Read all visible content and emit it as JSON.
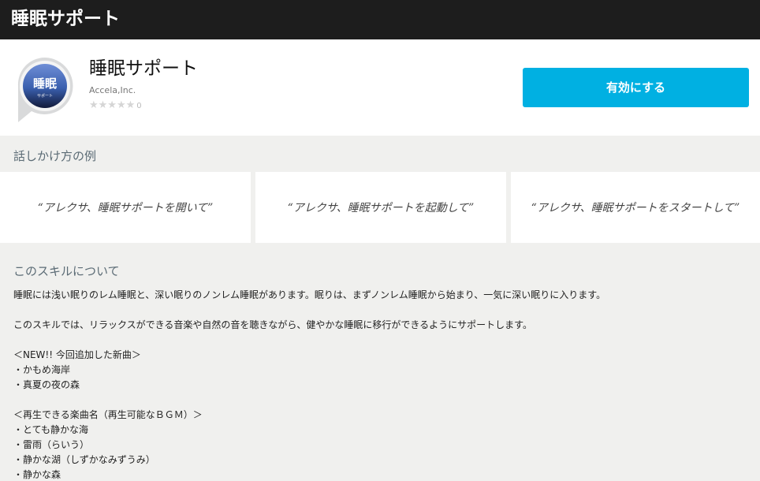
{
  "topbar": {
    "title": "睡眠サポート"
  },
  "skill": {
    "icon_text": "睡眠",
    "icon_subtext": "サポート",
    "name": "睡眠サポート",
    "developer": "Accela,Inc.",
    "stars": "★★★★★",
    "rating_count": "0",
    "enable_label": "有効にする"
  },
  "colors": {
    "accent": "#00b0e2",
    "topbar_bg": "#1d1d1d",
    "heading": "#5b6b75",
    "icon_blue": "#3a5fae"
  },
  "examples": {
    "heading": "話しかけ方の例",
    "items": [
      "“アレクサ、睡眠サポートを開いて”",
      "“アレクサ、睡眠サポートを起動して”",
      "“アレクサ、睡眠サポートをスタートして”"
    ]
  },
  "about": {
    "heading": "このスキルについて",
    "lines": [
      "睡眠には浅い眠りのレム睡眠と、深い眠りのノンレム睡眠があります。眠りは、まずノンレム睡眠から始まり、一気に深い眠りに入ります。",
      "",
      "このスキルでは、リラックスができる音楽や自然の音を聴きながら、健やかな睡眠に移行ができるようにサポートします。",
      "",
      "＜NEW!! 今回追加した新曲＞",
      "・かもめ海岸",
      "・真夏の夜の森",
      "",
      "＜再生できる楽曲名（再生可能なＢＧＭ）＞",
      "・とても静かな海",
      "・雷雨（らいう）",
      "・静かな湖（しずかなみずうみ）",
      "・静かな森"
    ]
  }
}
